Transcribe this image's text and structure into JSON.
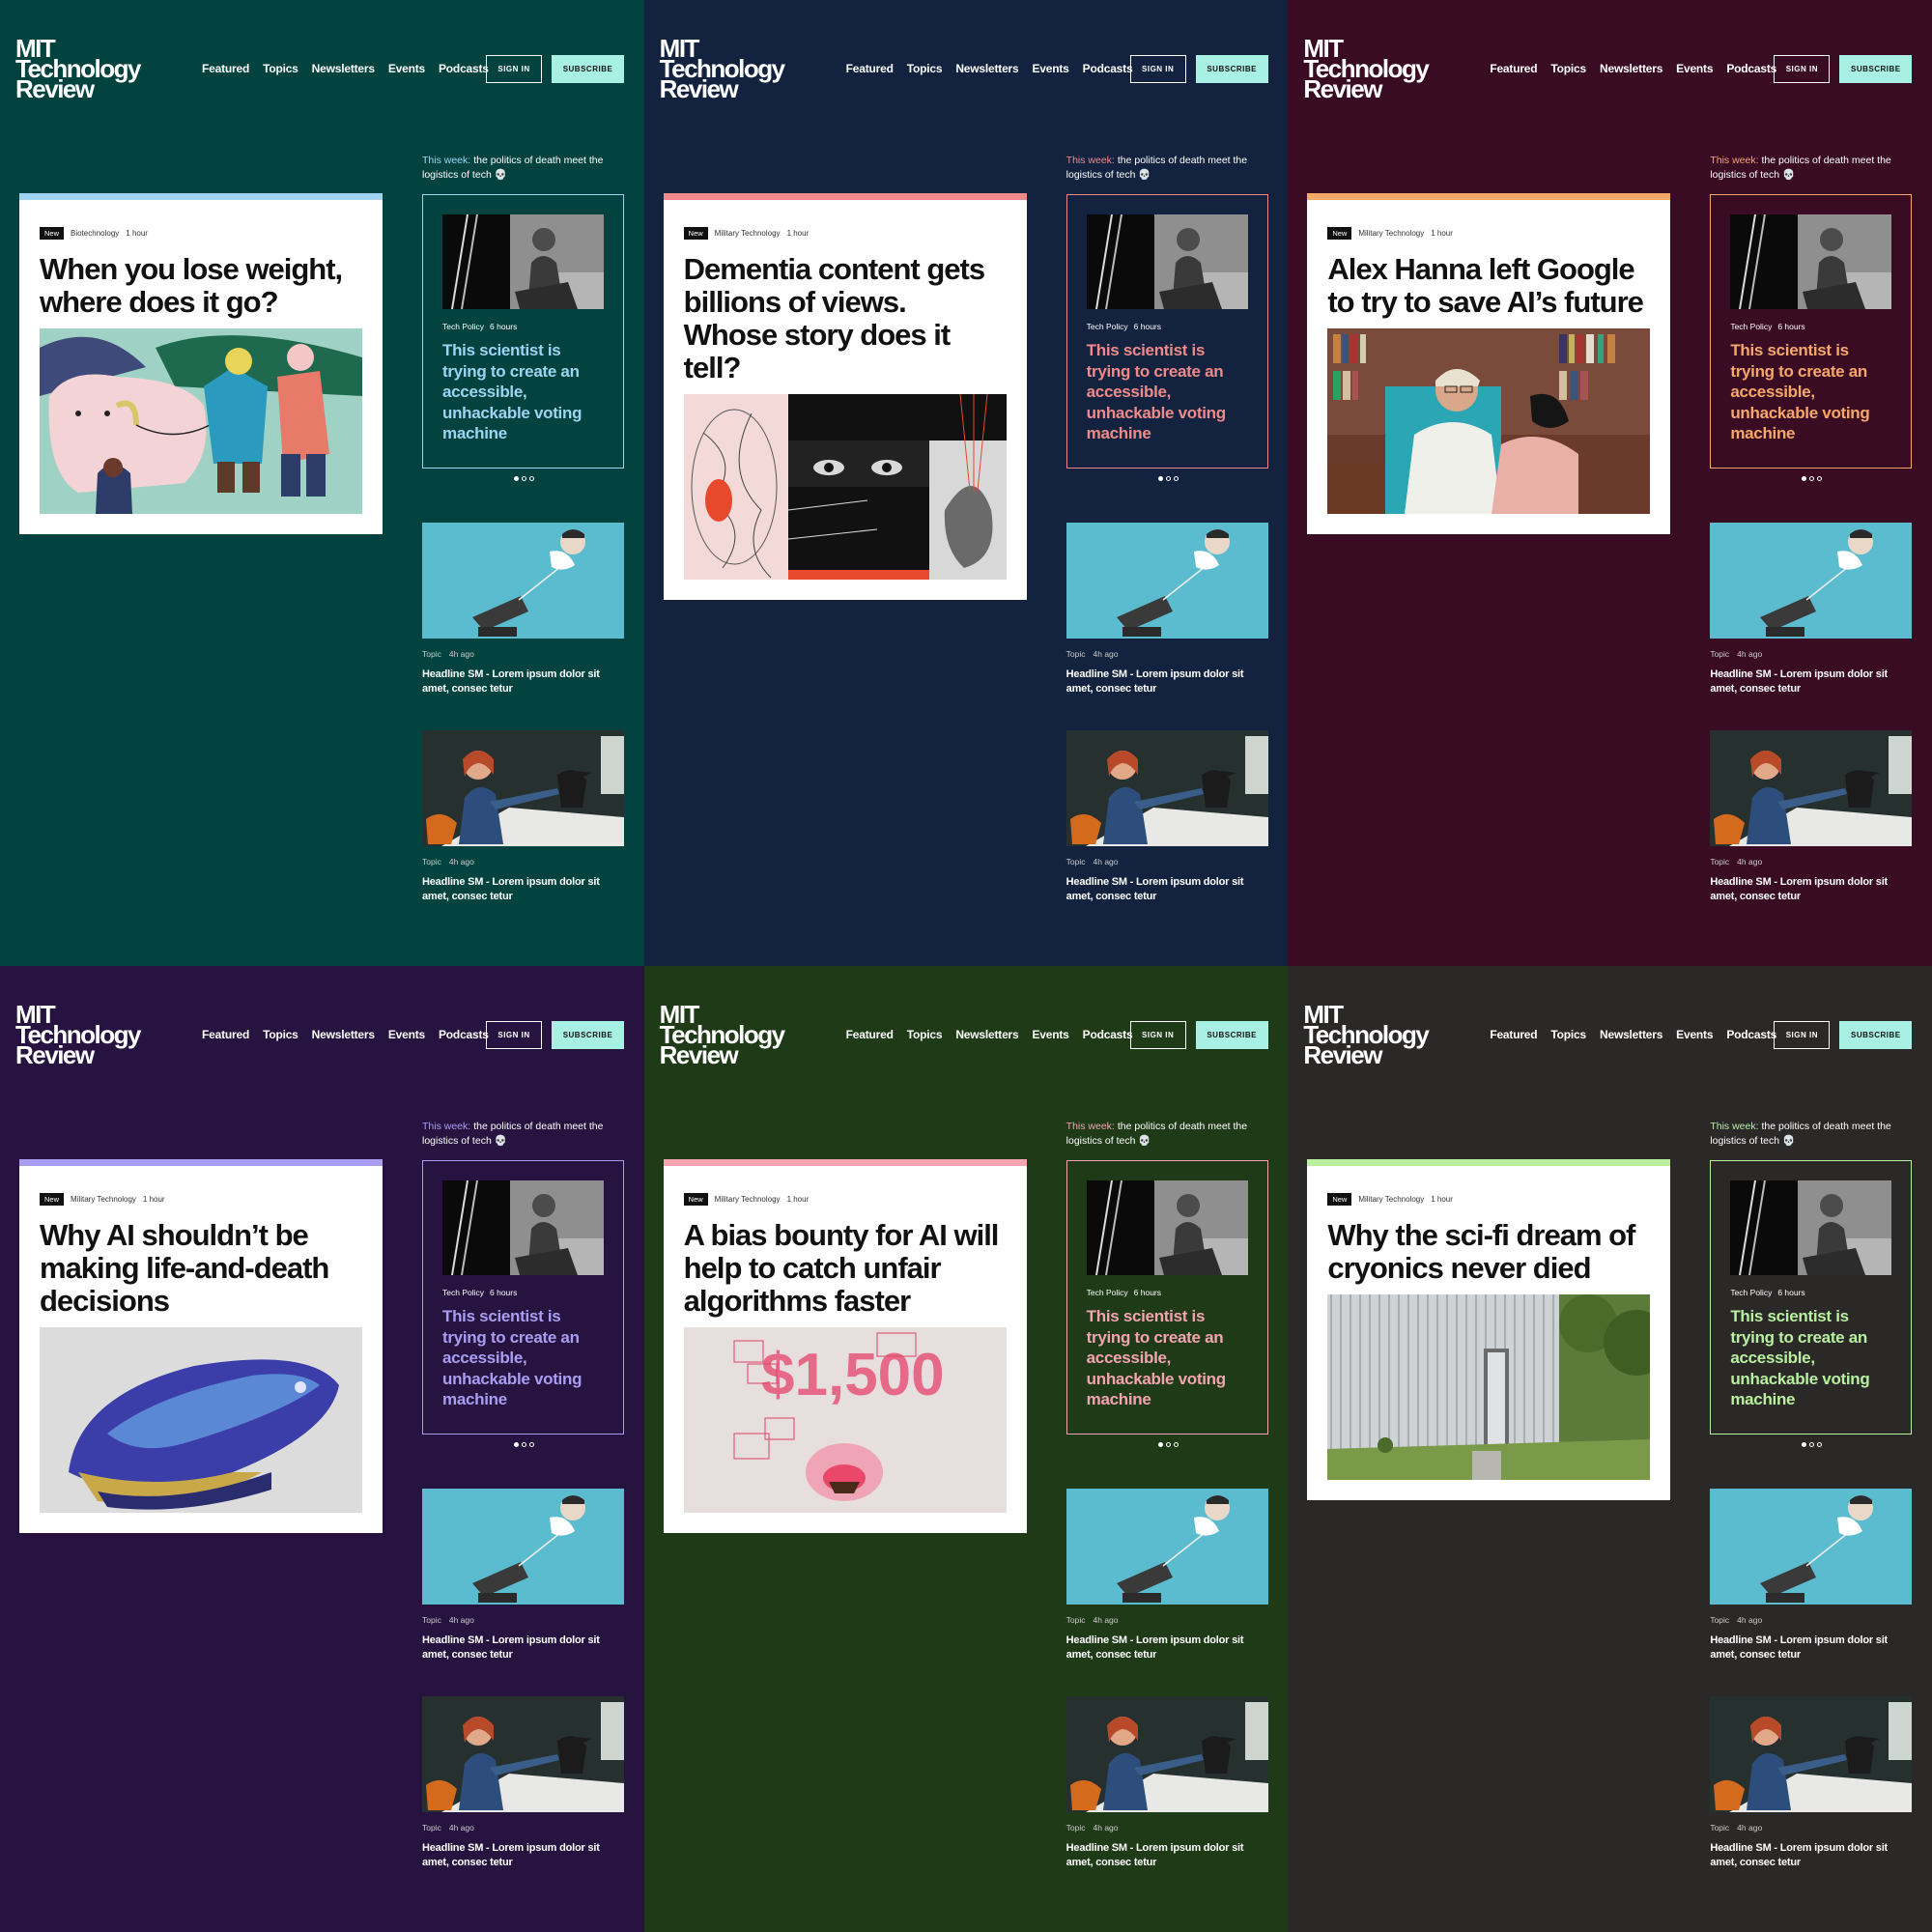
{
  "brand": {
    "line1": "MIT",
    "line2": "Technology",
    "line3": "Review"
  },
  "nav": [
    "Featured",
    "Topics",
    "Newsletters",
    "Events",
    "Podcasts"
  ],
  "signin_label": "SIGN IN",
  "subscribe_label": "SUBSCRIBE",
  "this_week": {
    "label": "This week:",
    "text": "the politics of death meet the logistics of tech 💀"
  },
  "side_card": {
    "category": "Tech Policy",
    "time": "6 hours",
    "title": "This scientist is trying to create an accessible, unhackable voting machine"
  },
  "stories": [
    {
      "topic": "Topic",
      "time": "4h ago",
      "title": "Headline SM - Lorem ipsum dolor sit amet, consec tetur"
    },
    {
      "topic": "Topic",
      "time": "4h ago",
      "title": "Headline SM - Lorem ipsum dolor sit amet, consec tetur"
    }
  ],
  "badge_label": "New",
  "panels": [
    {
      "bg": "#03433f",
      "accent": "#9fd3f2",
      "category": "Biotechnology",
      "time": "1 hour",
      "headline": "When you lose weight, where does it go?",
      "image": "illustration-bear-walk"
    },
    {
      "bg": "#13233f",
      "accent": "#f08a8a",
      "category": "Military Technology",
      "time": "1 hour",
      "headline": "Dementia content gets billions of views. Whose story does it tell?",
      "image": "brain-collage"
    },
    {
      "bg": "#3a0c24",
      "accent": "#f6a86b",
      "category": "Military Technology",
      "time": "1 hour",
      "headline": "Alex Hanna left Google to try to save AI’s future",
      "image": "portrait-bookshelf"
    },
    {
      "bg": "#26133f",
      "accent": "#a99df2",
      "category": "Military Technology",
      "time": "1 hour",
      "headline": "Why AI shouldn’t be making life-and-death decisions",
      "image": "pod-capsule"
    },
    {
      "bg": "#1f3a17",
      "accent": "#f4a3b0",
      "category": "Military Technology",
      "time": "1 hour",
      "headline": "A bias bounty for AI will help to catch unfair algorithms faster",
      "image": "bounty-1500"
    },
    {
      "bg": "#2b2828",
      "accent": "#b8f0a0",
      "category": "Military Technology",
      "time": "1 hour",
      "headline": "Why the sci-fi dream of cryonics never died",
      "image": "metal-shed"
    }
  ],
  "bounty_text": "$1,500"
}
